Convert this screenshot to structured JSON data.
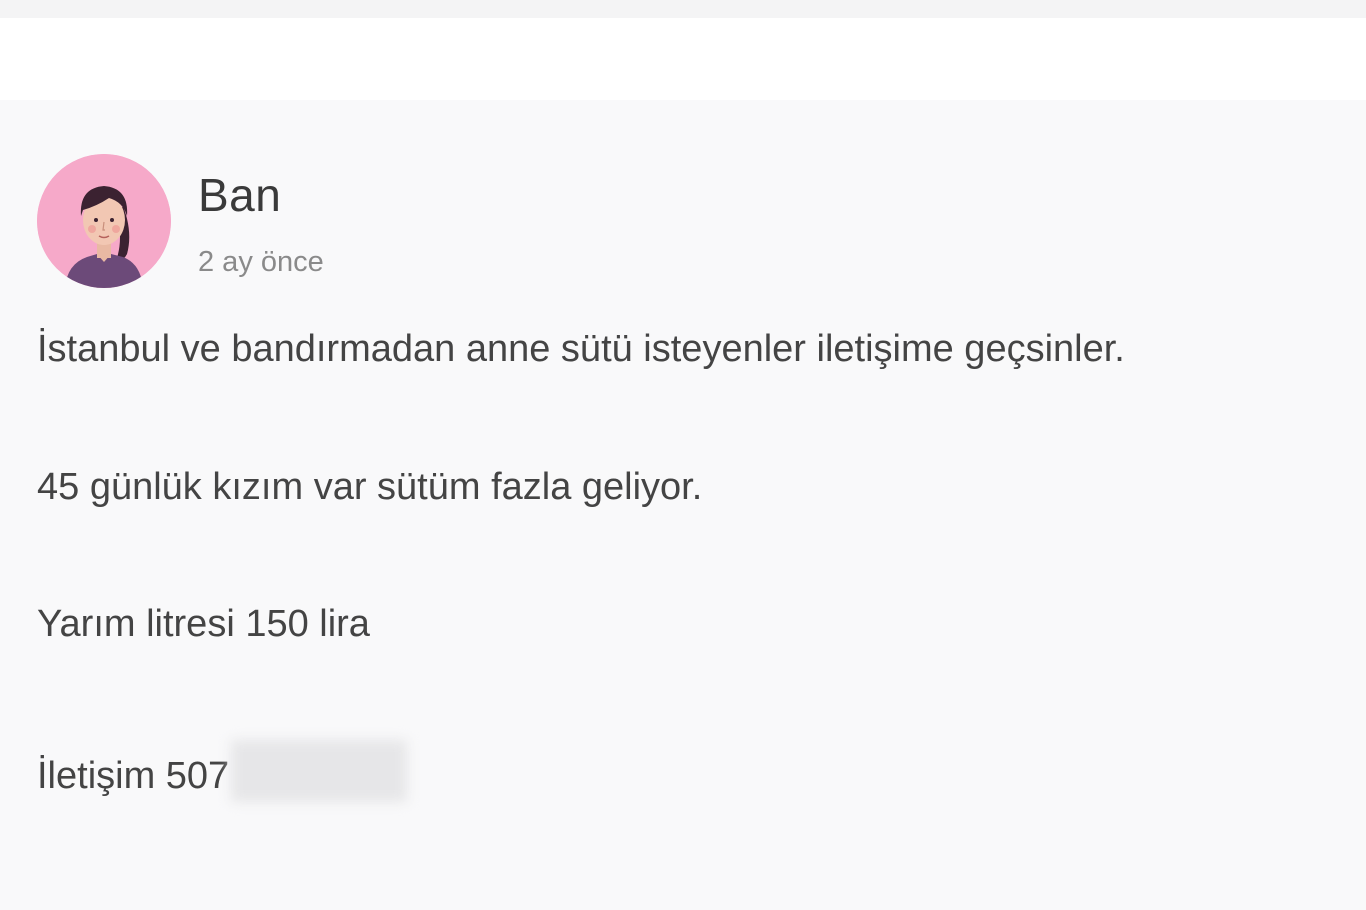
{
  "post": {
    "author": {
      "name": "Ban",
      "avatar_icon": "woman-avatar-icon"
    },
    "timestamp": "2 ay önce",
    "body_lines": [
      "İstanbul ve bandırmadan anne sütü isteyenler iletişime geçsinler.",
      "45 günlük kızım var sütüm fazla geliyor.",
      "Yarım litresi 150 lira"
    ],
    "contact_prefix": "İletişim 507"
  },
  "colors": {
    "page_background": "#f9f9fa",
    "header_background": "#ffffff",
    "avatar_background": "#f6a9c9",
    "text": "#444444",
    "muted_text": "#8a8a8a"
  }
}
